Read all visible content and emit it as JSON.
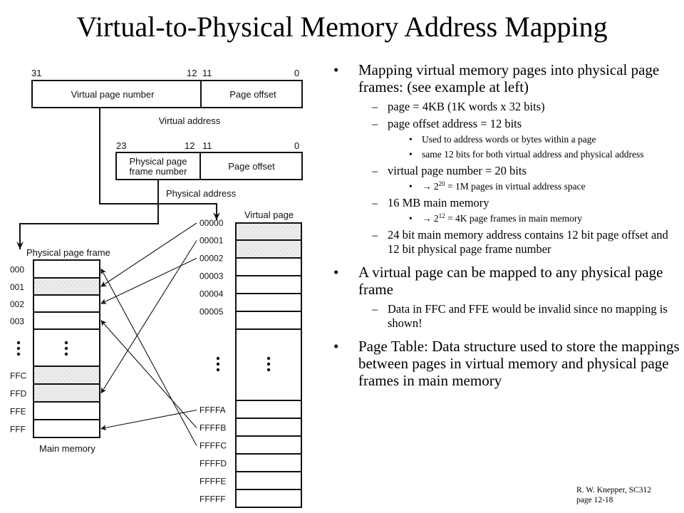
{
  "title": "Virtual-to-Physical Memory Address Mapping",
  "diagram": {
    "virtual_address": {
      "bit_labels": {
        "high": "31",
        "mid_high": "12",
        "mid_low": "11",
        "low": "0"
      },
      "field_vpn": "Virtual page number",
      "field_offset": "Page offset",
      "caption": "Virtual address"
    },
    "physical_address": {
      "bit_labels": {
        "high": "23",
        "mid_high": "12",
        "mid_low": "11",
        "low": "0"
      },
      "field_ppn_line1": "Physical page",
      "field_ppn_line2": "frame number",
      "field_offset": "Page offset",
      "caption": "Physical address"
    },
    "main_memory": {
      "heading": "Physical page frame",
      "caption": "Main memory",
      "frames": [
        {
          "label": "000",
          "shaded": false
        },
        {
          "label": "001",
          "shaded": true
        },
        {
          "label": "002",
          "shaded": false
        },
        {
          "label": "003",
          "shaded": false
        },
        {
          "label": "FFC",
          "shaded": true
        },
        {
          "label": "FFD",
          "shaded": true
        },
        {
          "label": "FFE",
          "shaded": false
        },
        {
          "label": "FFF",
          "shaded": false
        }
      ],
      "ellipsis": "⋮"
    },
    "virtual_pages": {
      "heading": "Virtual page",
      "pages": [
        {
          "label": "00000",
          "shaded": true
        },
        {
          "label": "00001",
          "shaded": true
        },
        {
          "label": "00002",
          "shaded": false
        },
        {
          "label": "00003",
          "shaded": false
        },
        {
          "label": "00004",
          "shaded": false
        },
        {
          "label": "00005",
          "shaded": false
        },
        {
          "label": "FFFFA",
          "shaded": false
        },
        {
          "label": "FFFFB",
          "shaded": false
        },
        {
          "label": "FFFFC",
          "shaded": false
        },
        {
          "label": "FFFFD",
          "shaded": false
        },
        {
          "label": "FFFFE",
          "shaded": false
        },
        {
          "label": "FFFFF",
          "shaded": false
        }
      ],
      "ellipsis": "⋮"
    },
    "mappings": [
      {
        "from": "00000",
        "to": "001"
      },
      {
        "from": "00001",
        "to": "FFD"
      },
      {
        "from": "00002",
        "to": "002"
      },
      {
        "from": "FFFFA",
        "to": "FFF"
      },
      {
        "from": "FFFFB",
        "to": "003"
      },
      {
        "from": "FFFFC",
        "to": "000"
      }
    ]
  },
  "bullets": [
    {
      "level": 1,
      "marker": "•",
      "text": "Mapping virtual memory pages into physical page frames:  (see example at left)"
    },
    {
      "level": 2,
      "marker": "–",
      "text": "page = 4KB (1K words x 32 bits)"
    },
    {
      "level": 2,
      "marker": "–",
      "text": "page offset address = 12 bits"
    },
    {
      "level": 3,
      "marker": "•",
      "text": "Used to address words or bytes within a page"
    },
    {
      "level": 3,
      "marker": "•",
      "text": "same 12 bits for both virtual address and physical address"
    },
    {
      "level": 2,
      "marker": "–",
      "text": "virtual page number = 20 bits"
    },
    {
      "level": 3,
      "marker": "•",
      "arrow": "→",
      "base": "2",
      "exp": "20",
      "text": " = 1M pages in virtual address space"
    },
    {
      "level": 2,
      "marker": "–",
      "text": "16 MB main memory"
    },
    {
      "level": 3,
      "marker": "•",
      "arrow": "→",
      "base": "2",
      "exp": "12",
      "text": " = 4K page frames in main memory"
    },
    {
      "level": 2,
      "marker": "–",
      "text": "24 bit main memory address contains 12 bit page offset and 12 bit physical page frame number"
    },
    {
      "level": 1,
      "marker": "•",
      "text": "A virtual page can be mapped to any physical page frame"
    },
    {
      "level": 2,
      "marker": "–",
      "text": "Data in FFC and FFE would be invalid since no mapping is shown!"
    },
    {
      "level": 1,
      "marker": "•",
      "text": "Page Table:  Data structure used to store the mappings between pages in virtual memory and physical page frames in main memory"
    }
  ],
  "footer": {
    "line1": "R. W.  Knepper, SC312",
    "line2": "page 12-18"
  }
}
